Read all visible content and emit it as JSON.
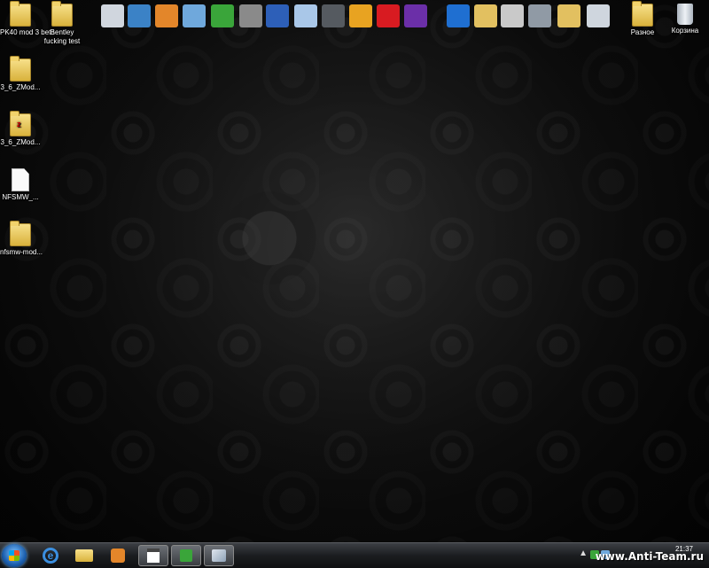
{
  "desktop": {
    "left_icons": [
      {
        "label": "PK40 mod 3 beta",
        "type": "folder"
      },
      {
        "label": "Bentley fucking test",
        "type": "folder"
      },
      {
        "label": "3_6_ZMod...",
        "type": "folder"
      },
      {
        "label": "3_6_ZMod...",
        "type": "zip"
      },
      {
        "label": "NFSMW_...",
        "type": "file"
      },
      {
        "label": "nfsmw-mod...",
        "type": "folder"
      }
    ],
    "right_icons": [
      {
        "label": "Разное",
        "type": "folder"
      },
      {
        "label": "Корзина",
        "type": "recycle-bin"
      }
    ],
    "quick_icons": [
      {
        "name": "presentation-icon",
        "color": "#d0d6de"
      },
      {
        "name": "network-icon",
        "color": "#3b82c6"
      },
      {
        "name": "media-player-icon",
        "color": "#e3862a"
      },
      {
        "name": "folder-open-icon",
        "color": "#6fa8dc"
      },
      {
        "name": "utorrent-icon",
        "color": "#3aa53a"
      },
      {
        "name": "tools-icon",
        "color": "#8a8a8a"
      },
      {
        "name": "floppy-save-icon",
        "color": "#2d5fb8"
      },
      {
        "name": "disc-icon",
        "color": "#a9c7e8"
      },
      {
        "name": "media-device-icon",
        "color": "#555a60"
      },
      {
        "name": "film-icon",
        "color": "#e8a321"
      },
      {
        "name": "opera-icon",
        "color": "#d81b21"
      },
      {
        "name": "zmod-icon",
        "color": "#6b2fa8"
      },
      {
        "name": "photoshop-icon",
        "color": "#1f6fd1"
      },
      {
        "name": "folder-icon",
        "color": "#e2c060"
      },
      {
        "name": "lens-99-icon",
        "color": "#c9c9c9"
      },
      {
        "name": "laptop-icon",
        "color": "#909aa5"
      },
      {
        "name": "folder-icon",
        "color": "#e2c060"
      },
      {
        "name": "recycle-bin-icon",
        "color": "#cfd6de"
      }
    ]
  },
  "taskbar": {
    "pinned": [
      {
        "name": "start-button"
      },
      {
        "name": "ie-button"
      },
      {
        "name": "explorer-button"
      },
      {
        "name": "media-player-button"
      },
      {
        "name": "calendar-app-button"
      },
      {
        "name": "utorrent-app-button"
      },
      {
        "name": "paint-app-button"
      }
    ],
    "clock_time": "21:37",
    "watermark": "www.Anti-Team.ru"
  }
}
